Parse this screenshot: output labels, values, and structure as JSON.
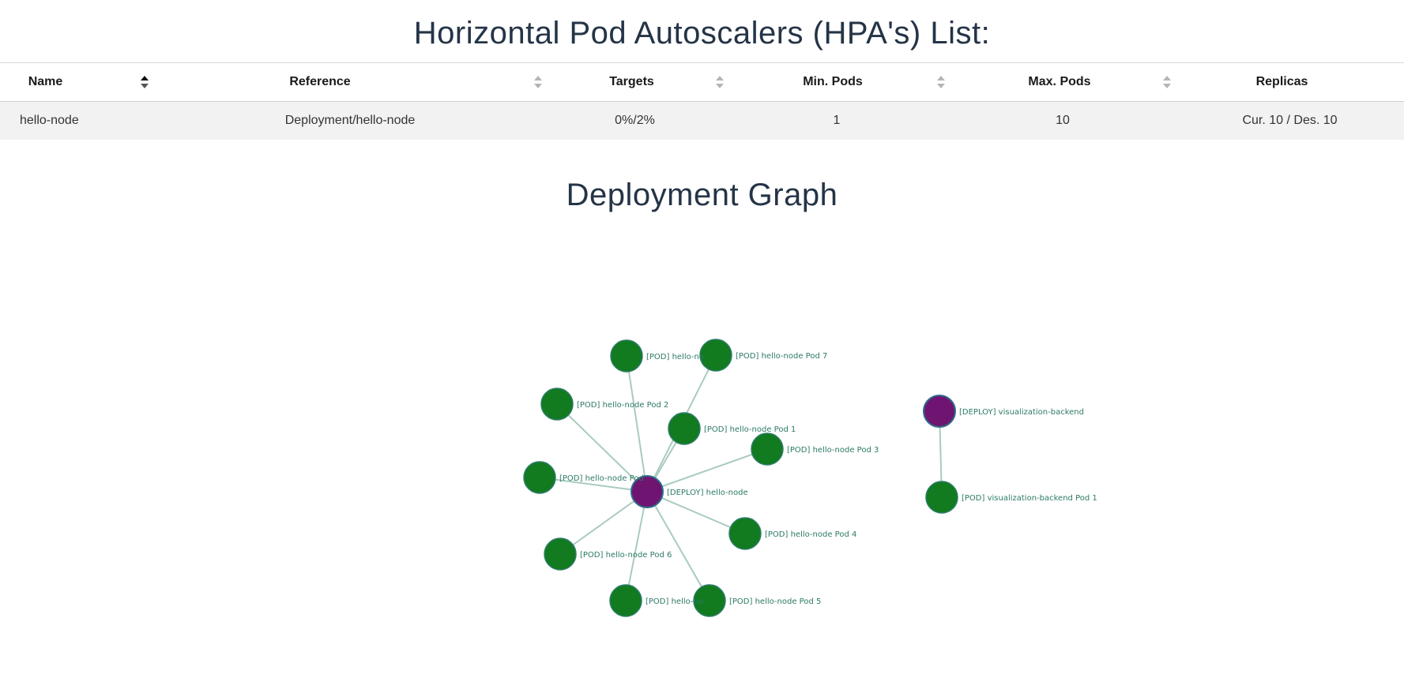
{
  "hpa": {
    "title": "Horizontal Pod Autoscalers (HPA's) List:",
    "columns": [
      {
        "label": "Name",
        "sort": "ascending"
      },
      {
        "label": "Reference",
        "sort": "none"
      },
      {
        "label": "Targets",
        "sort": "none"
      },
      {
        "label": "Min. Pods",
        "sort": "none"
      },
      {
        "label": "Max. Pods",
        "sort": "none"
      },
      {
        "label": "Replicas"
      }
    ],
    "rows": [
      {
        "name": "hello-node",
        "reference": "Deployment/hello-node",
        "targets": "0%/2%",
        "min_pods": "1",
        "max_pods": "10",
        "replicas": "Cur. 10 / Des. 10"
      }
    ]
  },
  "graph": {
    "title": "Deployment Graph",
    "colors": {
      "pod": "#127a1f",
      "deploy": "#6f1470",
      "edge": "#a9cbc0",
      "label": "#2c7a66"
    },
    "nodes": [
      {
        "id": "deploy-hello-node",
        "type": "deploy",
        "label": "[DEPLOY] hello-node"
      },
      {
        "id": "pod-1",
        "type": "pod",
        "label": "[POD] hello-node Pod 1"
      },
      {
        "id": "pod-2",
        "type": "pod",
        "label": "[POD] hello-node Pod 2"
      },
      {
        "id": "pod-3",
        "type": "pod",
        "label": "[POD] hello-node Pod 3"
      },
      {
        "id": "pod-4",
        "type": "pod",
        "label": "[POD] hello-node Pod 4"
      },
      {
        "id": "pod-5",
        "type": "pod",
        "label": "[POD] hello-node Pod 5"
      },
      {
        "id": "pod-6",
        "type": "pod",
        "label": "[POD] hello-node Pod 6"
      },
      {
        "id": "pod-7",
        "type": "pod",
        "label": "[POD] hello-node Pod 7"
      },
      {
        "id": "pod-a",
        "type": "pod",
        "label": "[POD] hello-node Pod"
      },
      {
        "id": "pod-b",
        "type": "pod",
        "label": "[POD] hello-no"
      },
      {
        "id": "pod-c",
        "type": "pod",
        "label": "[POD] hello-no"
      },
      {
        "id": "deploy-vis",
        "type": "deploy",
        "label": "[DEPLOY] visualization-backend"
      },
      {
        "id": "pod-vis-1",
        "type": "pod",
        "label": "[POD] visualization-backend Pod 1"
      }
    ],
    "edges": [
      [
        "deploy-hello-node",
        "pod-1"
      ],
      [
        "deploy-hello-node",
        "pod-2"
      ],
      [
        "deploy-hello-node",
        "pod-3"
      ],
      [
        "deploy-hello-node",
        "pod-4"
      ],
      [
        "deploy-hello-node",
        "pod-5"
      ],
      [
        "deploy-hello-node",
        "pod-6"
      ],
      [
        "deploy-hello-node",
        "pod-7"
      ],
      [
        "deploy-hello-node",
        "pod-a"
      ],
      [
        "deploy-hello-node",
        "pod-b"
      ],
      [
        "deploy-hello-node",
        "pod-c"
      ],
      [
        "deploy-vis",
        "pod-vis-1"
      ]
    ]
  }
}
